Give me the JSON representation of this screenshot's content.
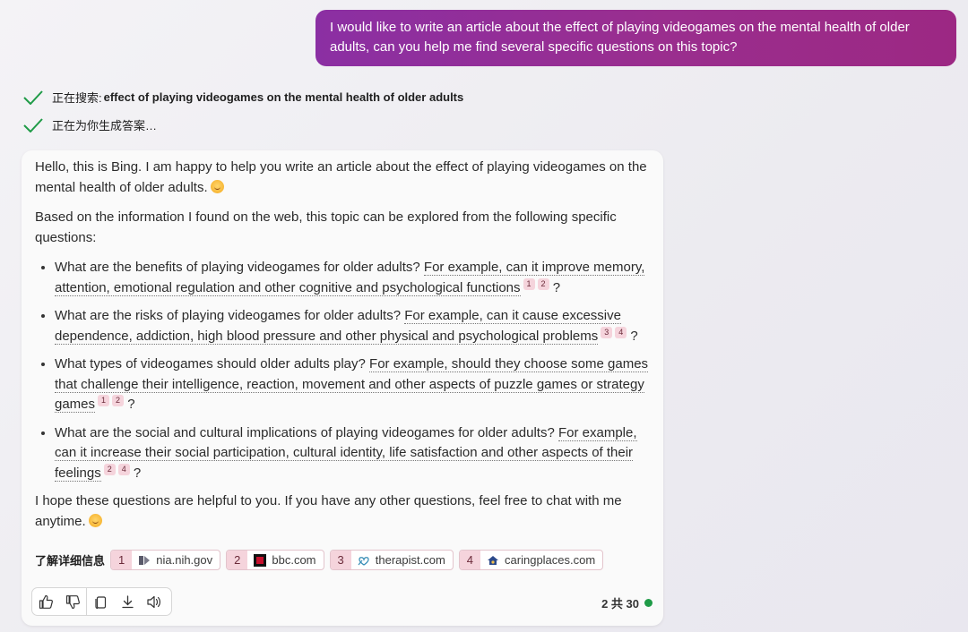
{
  "user_message": "I would like to write an article about the effect of playing videogames on the mental health of older adults, can you help me find several specific questions on this topic?",
  "status": {
    "searching_prefix": "正在搜索: ",
    "searching_query": "effect of playing videogames on the mental health of older adults",
    "generating": "正在为你生成答案…"
  },
  "answer": {
    "intro": "Hello, this is Bing. I am happy to help you write an article about the effect of playing videogames on the mental health of older adults.",
    "based_on": "Based on the information I found on the web, this topic can be explored from the following specific questions:",
    "questions": [
      {
        "question": "What are the benefits of playing videogames for older adults?",
        "example": "For example, can it improve memory, attention, emotional regulation and other cognitive and psychological functions",
        "citations": [
          "1",
          "2"
        ],
        "end": "?"
      },
      {
        "question": "What are the risks of playing videogames for older adults?",
        "example": "For example, can it cause excessive dependence, addiction, high blood pressure and other physical and psychological problems",
        "citations": [
          "3",
          "4"
        ],
        "end": "?"
      },
      {
        "question": "What types of videogames should older adults play?",
        "example": "For example, should they choose some games that challenge their intelligence, reaction, movement and other aspects of puzzle games or strategy games",
        "citations": [
          "1",
          "2"
        ],
        "end": "?"
      },
      {
        "question": "What are the social and cultural implications of playing videogames for older adults?",
        "example": "For example, can it increase their social participation, cultural identity, life satisfaction and other aspects of their feelings",
        "citations": [
          "2",
          "4"
        ],
        "end": "?"
      }
    ],
    "closing": "I hope these questions are helpful to you. If you have any other questions, feel free to chat with me anytime."
  },
  "learn_more": {
    "label": "了解详细信息",
    "sources": [
      {
        "num": "1",
        "domain": "nia.nih.gov",
        "icon": "nia-icon"
      },
      {
        "num": "2",
        "domain": "bbc.com",
        "icon": "bbc-icon"
      },
      {
        "num": "3",
        "domain": "therapist.com",
        "icon": "therapist-icon"
      },
      {
        "num": "4",
        "domain": "caringplaces.com",
        "icon": "caringplaces-icon"
      }
    ]
  },
  "toolbar": {
    "icons": [
      "thumbs-up-icon",
      "thumbs-down-icon",
      "copy-icon",
      "download-icon",
      "speaker-icon"
    ]
  },
  "turn_counter": "2 共 30",
  "colors": {
    "user_bubble": "#8b2fa3",
    "citation_bg": "#f5d4dc",
    "check": "#1f9b47",
    "status_dot": "#1f9b47"
  }
}
